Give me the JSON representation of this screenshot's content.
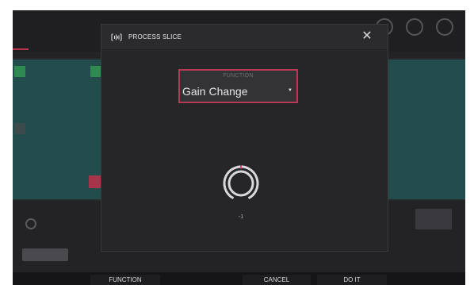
{
  "background": {
    "program_label": "",
    "program_name": "",
    "footer_buttons": {
      "function": "FUNCTION",
      "cancel": "CANCEL",
      "do_it": "DO IT"
    }
  },
  "modal": {
    "title": "PROCESS SLICE",
    "close_icon": "close-icon",
    "header_icon": "waveform-icon",
    "function_field": {
      "label": "FUNCTION",
      "value": "Gain Change"
    },
    "knob": {
      "value": "-1",
      "accent_color": "#e0486a"
    }
  },
  "colors": {
    "accent": "#b23a54",
    "modal_bg": "#2b2b2e",
    "screen_bg": "#232326"
  }
}
